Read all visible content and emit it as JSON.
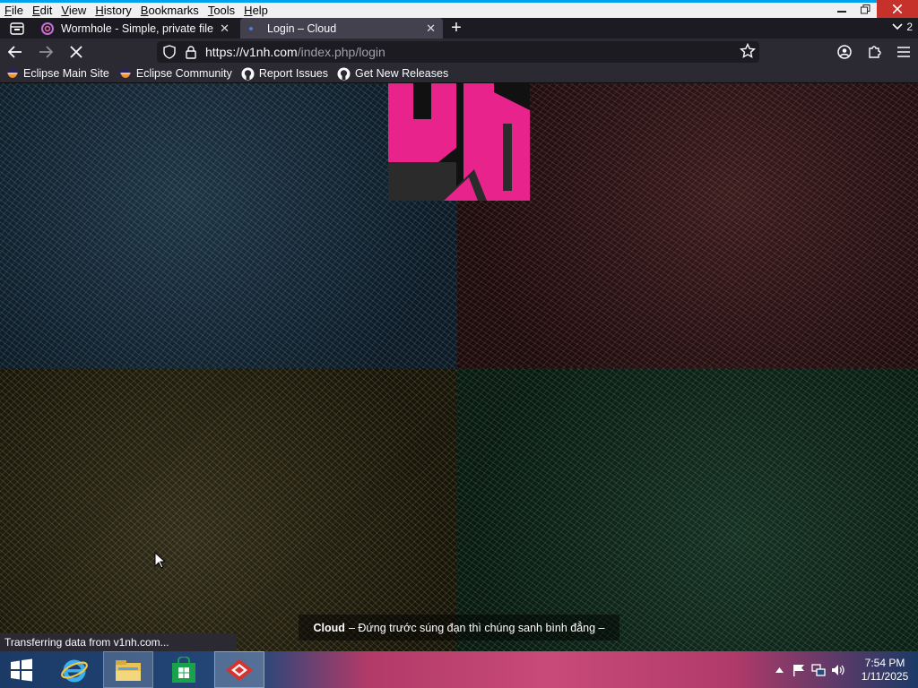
{
  "menubar": {
    "items": [
      {
        "label": "File",
        "key": "F",
        "rest": "ile"
      },
      {
        "label": "Edit",
        "key": "E",
        "rest": "dit"
      },
      {
        "label": "View",
        "key": "V",
        "rest": "iew"
      },
      {
        "label": "History",
        "key": "H",
        "rest": "istory"
      },
      {
        "label": "Bookmarks",
        "key": "B",
        "rest": "ookmarks"
      },
      {
        "label": "Tools",
        "key": "T",
        "rest": "ools"
      },
      {
        "label": "Help",
        "key": "H",
        "rest": "elp"
      }
    ]
  },
  "tabs": [
    {
      "title": "Wormhole - Simple, private file",
      "favicon": "wormhole-icon"
    },
    {
      "title": "Login – Cloud",
      "favicon": "loading-dot-icon"
    }
  ],
  "tabstrip": {
    "all_tabs_count": "2"
  },
  "urlbar": {
    "host": "https://v1nh.com",
    "path": "/index.php/login"
  },
  "bookmarks": [
    {
      "label": "Eclipse Main Site",
      "icon": "eclipse-icon"
    },
    {
      "label": "Eclipse Community",
      "icon": "eclipse-icon"
    },
    {
      "label": "Report Issues",
      "icon": "github-icon"
    },
    {
      "label": "Get New Releases",
      "icon": "github-icon"
    }
  ],
  "page": {
    "footer_brand": "Cloud",
    "footer_slogan": "– Đứng trước súng đạn thì chúng sanh bình đẳng –"
  },
  "status": {
    "text": "Transferring data from v1nh.com..."
  },
  "taskbar": {
    "time": "7:54 PM",
    "date": "1/11/2025"
  },
  "colors": {
    "logo_pink": "#e8248c",
    "logo_dark": "#2b2b2b",
    "browser_chrome": "#2b2a33",
    "tab_active": "#42414d",
    "close_button": "#c7312b"
  }
}
